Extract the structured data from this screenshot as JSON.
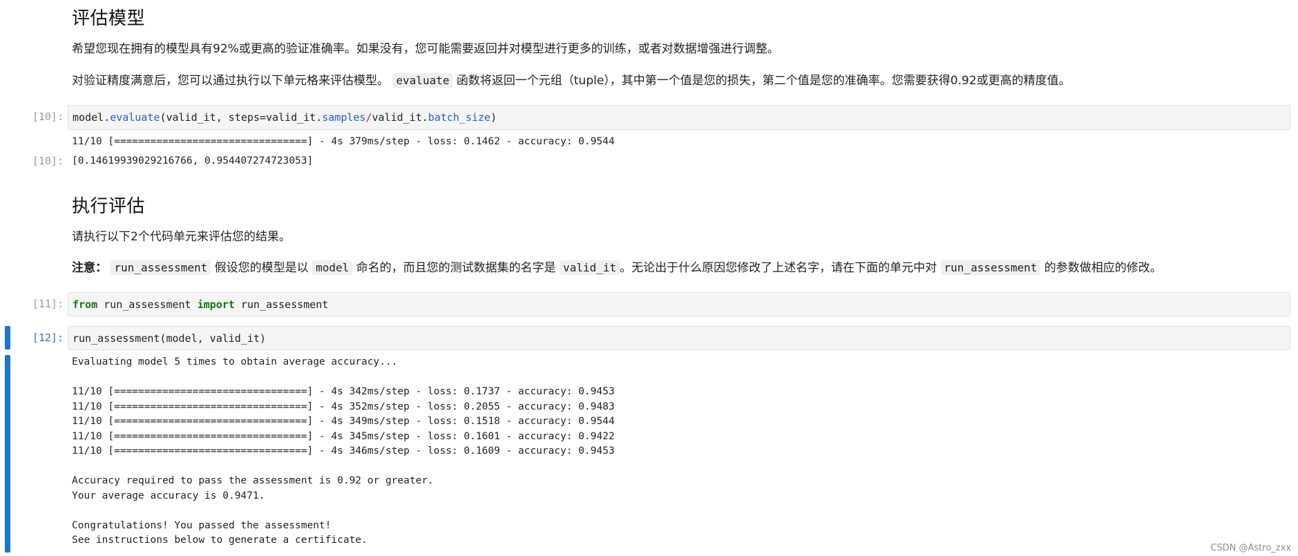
{
  "section1": {
    "heading": "评估模型",
    "para1": "希望您现在拥有的模型具有92%或更高的验证准确率。如果没有，您可能需要返回并对模型进行更多的训练，或者对数据增强进行调整。",
    "para2_pre": "对验证精度满意后，您可以通过执行以下单元格来评估模型。",
    "para2_code": "evaluate",
    "para2_post": "函数将返回一个元组（tuple），其中第一个值是您的损失，第二个值是您的准确率。您需要获得0.92或更高的精度值。"
  },
  "cell10": {
    "prompt": "[10]:",
    "code": {
      "p1": "model.",
      "evaluate": "evaluate",
      "p2": "(valid_it, steps=valid_it.",
      "samples": "samples",
      "slash": "/",
      "p3": "valid_it.",
      "batch_size": "batch_size",
      "p4": ")"
    },
    "stream": "11/10 [================================] - 4s 379ms/step - loss: 0.1462 - accuracy: 0.9544",
    "out_prompt": "[10]:",
    "result": "[0.14619939029216766, 0.954407274723053]"
  },
  "section2": {
    "heading": "执行评估",
    "para1": "请执行以下2个代码单元来评估您的结果。",
    "note_label": "注意：",
    "c1": "run_assessment",
    "t1": "假设您的模型是以",
    "c2": "model",
    "t2": "命名的，而且您的测试数据集的名字是",
    "c3": "valid_it",
    "t3": "。无论出于什么原因您修改了上述名字，请在下面的单元中对",
    "c4": "run_assessment",
    "t4": "的参数做相应的修改。"
  },
  "cell11": {
    "prompt": "[11]:",
    "kw_from": "from",
    "module": " run_assessment ",
    "kw_import": "import",
    "name": " run_assessment"
  },
  "cell12": {
    "prompt": "[12]:",
    "code": "run_assessment(model, valid_it)",
    "output": "Evaluating model 5 times to obtain average accuracy...\n\n11/10 [================================] - 4s 342ms/step - loss: 0.1737 - accuracy: 0.9453\n11/10 [================================] - 4s 352ms/step - loss: 0.2055 - accuracy: 0.9483\n11/10 [================================] - 4s 349ms/step - loss: 0.1518 - accuracy: 0.9544\n11/10 [================================] - 4s 345ms/step - loss: 0.1601 - accuracy: 0.9422\n11/10 [================================] - 4s 346ms/step - loss: 0.1609 - accuracy: 0.9453\n\nAccuracy required to pass the assessment is 0.92 or greater.\nYour average accuracy is 0.9471.\n\nCongratulations! You passed the assessment!\nSee instructions below to generate a certificate."
  },
  "watermark": "CSDN @Astro_zxx",
  "colors": {
    "active_bar": "#1976d2",
    "keyword": "#0b7a0b",
    "attribute": "#1f62c7",
    "operator": "#a626a4"
  }
}
